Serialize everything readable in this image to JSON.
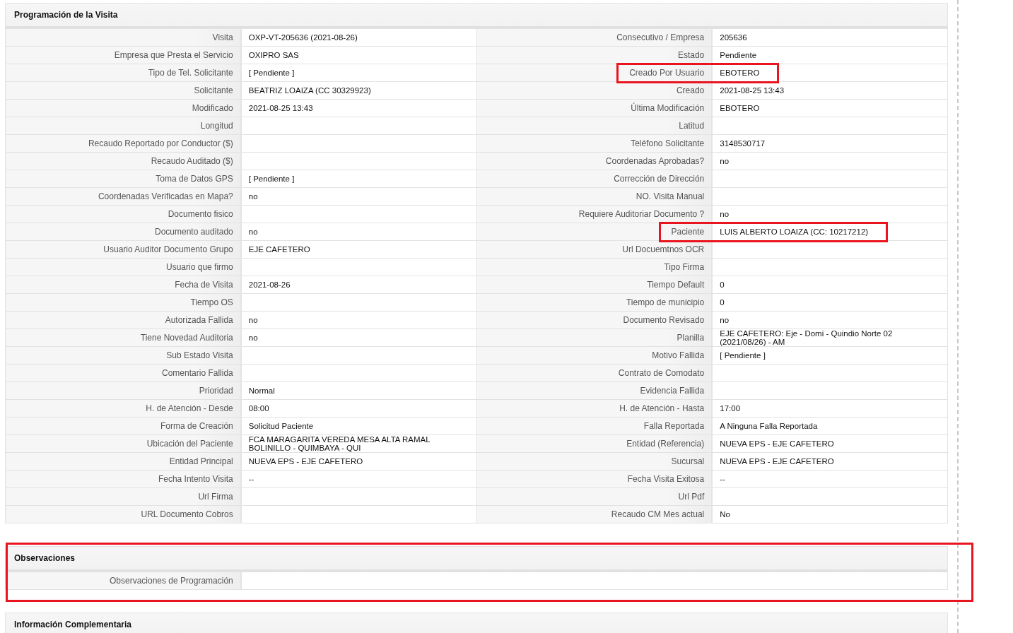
{
  "sections": [
    {
      "title": "Programación de la Visita",
      "rows": [
        [
          {
            "label": "Visita",
            "value": "OXP-VT-205636 (2021-08-26)"
          },
          {
            "label": "Consecutivo / Empresa",
            "value": "205636"
          }
        ],
        [
          {
            "label": "Empresa que Presta el Servicio",
            "value": "OXIPRO SAS"
          },
          {
            "label": "Estado",
            "value": "Pendiente"
          }
        ],
        [
          {
            "label": "Tipo de Tel. Solicitante",
            "value": "[ Pendiente ]"
          },
          {
            "label": "Creado Por Usuario",
            "value": "EBOTERO",
            "highlighted": true
          }
        ],
        [
          {
            "label": "Solicitante",
            "value": "BEATRIZ LOAIZA (CC 30329923)"
          },
          {
            "label": "Creado",
            "value": "2021-08-25 13:43"
          }
        ],
        [
          {
            "label": "Modificado",
            "value": "2021-08-25 13:43"
          },
          {
            "label": "Última Modificación",
            "value": "EBOTERO"
          }
        ],
        [
          {
            "label": "Longitud"
          },
          {
            "label": "Latitud"
          }
        ],
        [
          {
            "label": "Recaudo Reportado por Conductor ($)"
          },
          {
            "label": "Teléfono Solicitante",
            "value": "3148530717"
          }
        ],
        [
          {
            "label": "Recaudo Auditado ($)"
          },
          {
            "label": "Coordenadas Aprobadas?",
            "value": "no"
          }
        ],
        [
          {
            "label": "Toma de Datos GPS",
            "value": "[ Pendiente ]"
          },
          {
            "label": "Corrección de Dirección"
          }
        ],
        [
          {
            "label": "Coordenadas Verificadas en Mapa?",
            "value": "no"
          },
          {
            "label": "NO. Visita Manual"
          }
        ],
        [
          {
            "label": "Documento fisico"
          },
          {
            "label": "Requiere Auditoriar Documento ?",
            "value": "no"
          }
        ],
        [
          {
            "label": "Documento auditado",
            "value": "no"
          },
          {
            "label": "Paciente",
            "value": "LUIS ALBERTO LOAIZA (CC: 10217212)",
            "highlighted": true
          }
        ],
        [
          {
            "label": "Usuario Auditor Documento Grupo",
            "value": "EJE CAFETERO"
          },
          {
            "label": "Url Docuemtnos OCR"
          }
        ],
        [
          {
            "label": "Usuario que firmo"
          },
          {
            "label": "Tipo Firma"
          }
        ],
        [
          {
            "label": "Fecha de Visita",
            "value": "2021-08-26"
          },
          {
            "label": "Tiempo Default",
            "value": "0"
          }
        ],
        [
          {
            "label": "Tiempo OS"
          },
          {
            "label": "Tiempo de municipio",
            "value": "0"
          }
        ],
        [
          {
            "label": "Autorizada Fallida",
            "value": "no"
          },
          {
            "label": "Documento Revisado",
            "value": "no"
          }
        ],
        [
          {
            "label": "Tiene Novedad Auditoria",
            "value": "no"
          },
          {
            "label": "Planilla",
            "value": "EJE CAFETERO: Eje - Domi - Quindio Norte 02 (2021/08/26) - AM"
          }
        ],
        [
          {
            "label": "Sub Estado Visita"
          },
          {
            "label": "Motivo Fallida",
            "value": "[ Pendiente ]"
          }
        ],
        [
          {
            "label": "Comentario Fallida"
          },
          {
            "label": "Contrato de Comodato"
          }
        ],
        [
          {
            "label": "Prioridad",
            "value": "Normal"
          },
          {
            "label": "Evidencia Fallida"
          }
        ],
        [
          {
            "label": "H. de Atención - Desde",
            "value": "08:00"
          },
          {
            "label": "H. de Atención - Hasta",
            "value": "17:00"
          }
        ],
        [
          {
            "label": "Forma de Creación",
            "value": "Solicitud Paciente"
          },
          {
            "label": "Falla Reportada",
            "value": "A Ninguna Falla Reportada"
          }
        ],
        [
          {
            "label": "Ubicación del Paciente",
            "value": "FCA MARAGARITA VEREDA MESA ALTA RAMAL BOLINILLO - QUIMBAYA - QUI"
          },
          {
            "label": "Entidad (Referencia)",
            "value": "NUEVA EPS - EJE CAFETERO"
          }
        ],
        [
          {
            "label": "Entidad Principal",
            "value": "NUEVA EPS - EJE CAFETERO"
          },
          {
            "label": "Sucursal",
            "value": "NUEVA EPS - EJE CAFETERO"
          }
        ],
        [
          {
            "label": "Fecha Intento Visita",
            "value": "--"
          },
          {
            "label": "Fecha Visita Exitosa",
            "value": "--"
          }
        ],
        [
          {
            "label": "Url Firma"
          },
          {
            "label": "Url Pdf"
          }
        ],
        [
          {
            "label": "URL Documento Cobros"
          },
          {
            "label": "Recaudo CM Mes actual",
            "value": "No"
          }
        ]
      ]
    },
    {
      "title": "Observaciones",
      "highlighted": true,
      "rows": [
        [
          {
            "label": "Observaciones de Programación"
          }
        ]
      ]
    },
    {
      "title": "Información Complementaria"
    }
  ]
}
